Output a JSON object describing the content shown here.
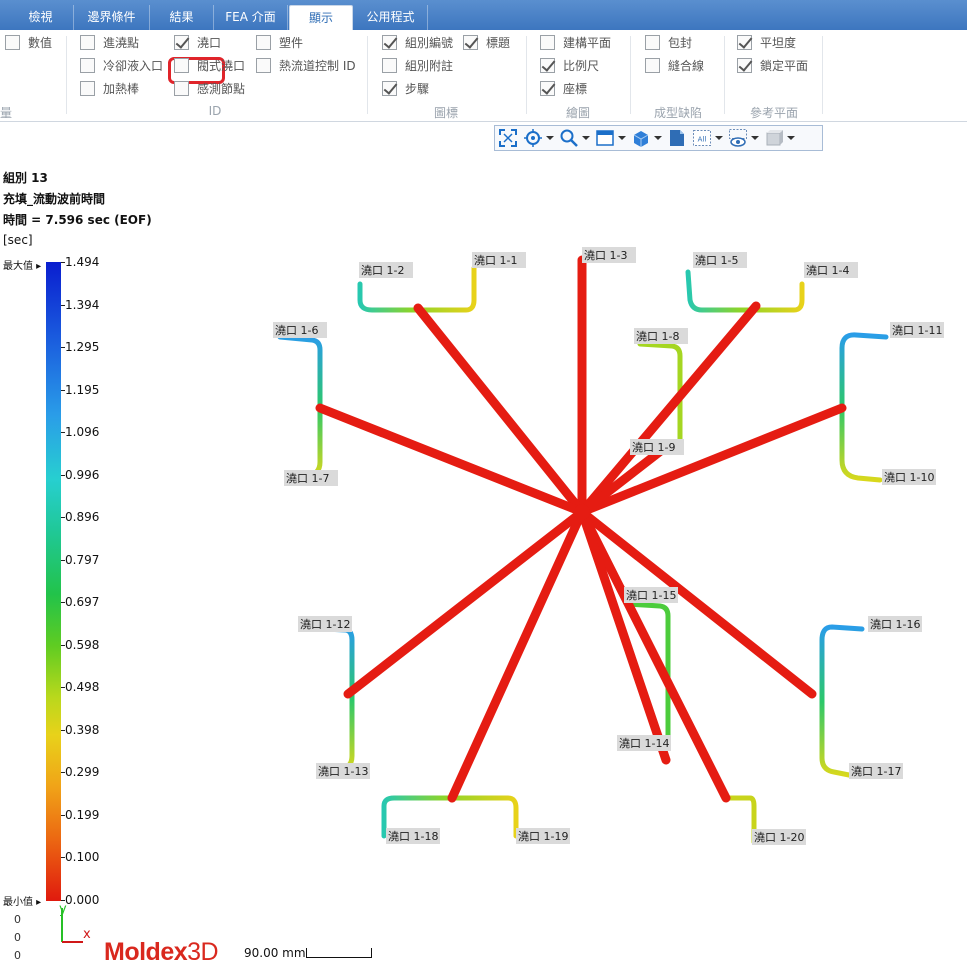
{
  "tabs": [
    {
      "label": "檢視",
      "active": false
    },
    {
      "label": "邊界條件",
      "active": false
    },
    {
      "label": "結果",
      "active": false
    },
    {
      "label": "FEA 介面",
      "active": false
    },
    {
      "label": "顯示",
      "active": true
    },
    {
      "label": "公用程式",
      "active": false
    }
  ],
  "ribbon": {
    "checkboxes": {
      "numeric": {
        "label": "數值",
        "checked": false
      },
      "inlet_point": {
        "label": "進澆點",
        "checked": false
      },
      "coolant_inlet": {
        "label": "冷卻液入口",
        "checked": false
      },
      "heater": {
        "label": "加熱棒",
        "checked": false
      },
      "gate": {
        "label": "澆口",
        "checked": true
      },
      "valve_gate": {
        "label": "閥式澆口",
        "checked": false
      },
      "sensor_node": {
        "label": "感測節點",
        "checked": false
      },
      "part": {
        "label": "塑件",
        "checked": false
      },
      "hot_runner_id": {
        "label": "熱流道控制 ID",
        "checked": false
      },
      "group_number": {
        "label": "組別編號",
        "checked": true
      },
      "title": {
        "label": "標題",
        "checked": true
      },
      "group_note": {
        "label": "組別附註",
        "checked": false
      },
      "step": {
        "label": "步驟",
        "checked": true
      },
      "construction_plane": {
        "label": "建構平面",
        "checked": false
      },
      "scale": {
        "label": "比例尺",
        "checked": true
      },
      "coordinate": {
        "label": "座標",
        "checked": true
      },
      "air_trap": {
        "label": "包封",
        "checked": false
      },
      "weld_line": {
        "label": "縫合線",
        "checked": false
      },
      "flatness": {
        "label": "平坦度",
        "checked": true
      },
      "lock_plane": {
        "label": "鎖定平面",
        "checked": true
      }
    },
    "groups": {
      "quantity_partial": "量",
      "id": "ID",
      "layer": "圖標",
      "drawing": "繪圖",
      "defects": "成型缺陷",
      "reference": "參考平面"
    }
  },
  "info": {
    "group": "組別 13",
    "result_name": "充填_流動波前時間",
    "time": "時間 = 7.596 sec (EOF)",
    "unit": "[sec]"
  },
  "legend": {
    "max_label": "最大值",
    "min_label": "最小值",
    "values": [
      "1.494",
      "1.394",
      "1.295",
      "1.195",
      "1.096",
      "0.996",
      "0.896",
      "0.797",
      "0.697",
      "0.598",
      "0.498",
      "0.398",
      "0.299",
      "0.199",
      "0.100",
      "0.000"
    ],
    "colors": {
      "max": "#0a1ecf",
      "min": "#e01a0e"
    }
  },
  "axis": {
    "x_label": "x",
    "y_label": "y",
    "coords": [
      "0",
      "0",
      "0"
    ]
  },
  "gates": [
    "澆口 1-1",
    "澆口 1-2",
    "澆口 1-3",
    "澆口 1-4",
    "澆口 1-5",
    "澆口 1-6",
    "澆口 1-7",
    "澆口 1-8",
    "澆口 1-9",
    "澆口 1-10",
    "澆口 1-11",
    "澆口 1-12",
    "澆口 1-13",
    "澆口 1-14",
    "澆口 1-15",
    "澆口 1-16",
    "澆口 1-17",
    "澆口 1-18",
    "澆口 1-19",
    "澆口 1-20"
  ],
  "brand": {
    "name_bold": "Moldex",
    "name_suffix": "3D"
  },
  "scale": {
    "text": "90.00 mm"
  },
  "toolbar_icons": [
    "fit-view-icon",
    "center-rotate-icon",
    "zoom-icon",
    "window-icon",
    "cube-view-icon",
    "page-icon",
    "all-icon",
    "visibility-icon",
    "display-mode-icon"
  ]
}
